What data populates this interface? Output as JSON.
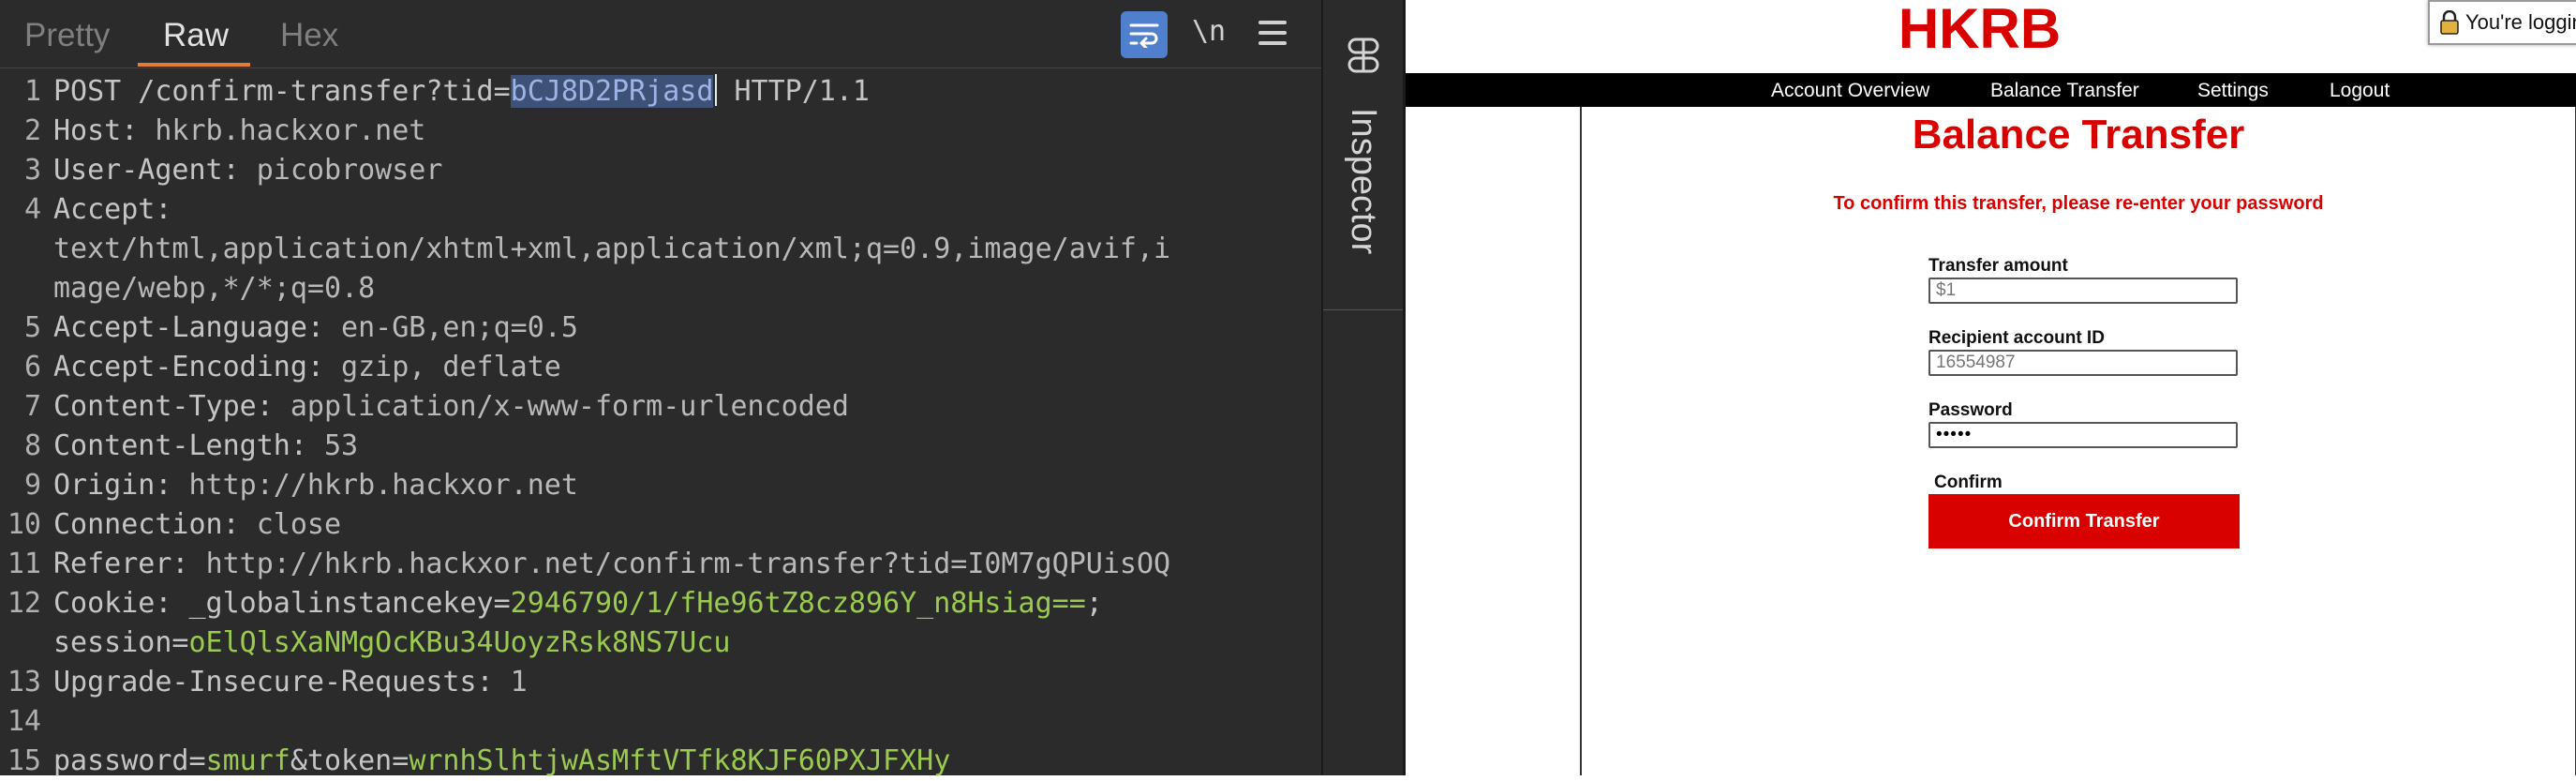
{
  "editor": {
    "tabs": {
      "pretty": "Pretty",
      "raw": "Raw",
      "hex": "Hex"
    },
    "newline_toggle": "\\n",
    "lines": [
      {
        "num": "1",
        "pre": "POST /confirm-transfer?tid=",
        "selected": "bCJ8D2PRjasd",
        "post": " HTTP/1.1"
      },
      {
        "num": "2",
        "key": "Host: ",
        "val": "hkrb.hackxor.net"
      },
      {
        "num": "3",
        "key": "User-Agent: ",
        "val": "picobrowser"
      },
      {
        "num": "4",
        "key": "Accept:",
        "val": ""
      },
      {
        "num": "",
        "cont": "text/html,application/xhtml+xml,application/xml;q=0.9,image/avif,i"
      },
      {
        "num": "",
        "cont": "mage/webp,*/*;q=0.8"
      },
      {
        "num": "5",
        "key": "Accept-Language: ",
        "val": "en-GB,en;q=0.5"
      },
      {
        "num": "6",
        "key": "Accept-Encoding: ",
        "val": "gzip, deflate"
      },
      {
        "num": "7",
        "key": "Content-Type: ",
        "val": "application/x-www-form-urlencoded"
      },
      {
        "num": "8",
        "key": "Content-Length: ",
        "val": "53"
      },
      {
        "num": "9",
        "key": "Origin: ",
        "val": "http://hkrb.hackxor.net"
      },
      {
        "num": "10",
        "key": "Connection: ",
        "val": "close"
      },
      {
        "num": "11",
        "key": "Referer: ",
        "val": "http://hkrb.hackxor.net/confirm-transfer?tid=I0M7gQPUisOQ"
      },
      {
        "num": "12",
        "key": "Cookie: _globalinstancekey=",
        "green": "2946790/1/fHe96tZ8cz896Y_n8Hsiag==",
        "tail": ";"
      },
      {
        "num": "",
        "key": "session=",
        "green": "oElQlsXaNMgOcKBu34UoyzRsk8NS7Ucu",
        "tail": ""
      },
      {
        "num": "13",
        "key": "Upgrade-Insecure-Requests: ",
        "val": "1"
      },
      {
        "num": "14",
        "key": "",
        "val": ""
      },
      {
        "num": "15",
        "key": "password=",
        "green": "smurf",
        "key2": "&token=",
        "green2": "wrnhSlhtjwAsMftVTfk8KJF60PXJFXHy"
      }
    ]
  },
  "inspector": {
    "label": "Inspector"
  },
  "browser": {
    "logo": "HKRB",
    "login_status": "You're loggin",
    "nav": {
      "overview": "Account Overview",
      "transfer": "Balance Transfer",
      "settings": "Settings",
      "logout": "Logout"
    },
    "page_title": "Balance Transfer",
    "confirm_message": "To confirm this transfer, please re-enter your password",
    "form": {
      "amount_label": "Transfer amount",
      "amount_value": "$1",
      "recipient_label": "Recipient account ID",
      "recipient_value": "16554987",
      "password_label": "Password",
      "password_value": "smurf",
      "confirm_label": "Confirm",
      "confirm_button": "Confirm Transfer"
    }
  },
  "colors": {
    "brand_red": "#d90000",
    "editor_bg": "#2b2b2b",
    "active_tab_underline": "#e57d3a",
    "param_value_green": "#9acb50",
    "selection_bg": "#3e5177"
  },
  "icons": {
    "wrap": "wrap-lines-icon",
    "menu": "hamburger-menu-icon",
    "inspector": "inspector-icon",
    "lock": "lock-icon"
  }
}
